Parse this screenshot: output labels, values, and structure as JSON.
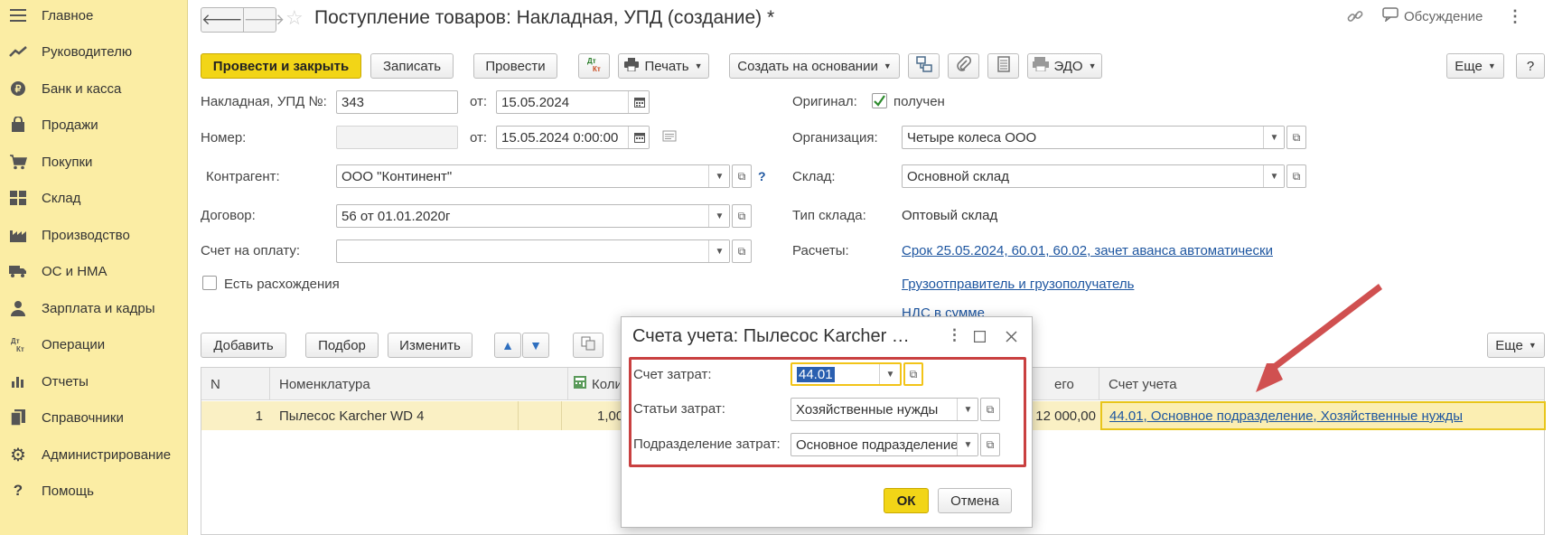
{
  "sidebar": {
    "items": [
      {
        "label": "Главное",
        "icon": "menu-icon"
      },
      {
        "label": "Руководителю",
        "icon": "trend-icon"
      },
      {
        "label": "Банк и касса",
        "icon": "coin-icon"
      },
      {
        "label": "Продажи",
        "icon": "bag-icon"
      },
      {
        "label": "Покупки",
        "icon": "cart-icon"
      },
      {
        "label": "Склад",
        "icon": "warehouse-icon"
      },
      {
        "label": "Производство",
        "icon": "factory-icon"
      },
      {
        "label": "ОС и НМА",
        "icon": "truck-icon"
      },
      {
        "label": "Зарплата и кадры",
        "icon": "person-icon"
      },
      {
        "label": "Операции",
        "icon": "dt-kt-icon"
      },
      {
        "label": "Отчеты",
        "icon": "bar-chart-icon"
      },
      {
        "label": "Справочники",
        "icon": "book-icon"
      },
      {
        "label": "Администрирование",
        "icon": "gear-icon"
      },
      {
        "label": "Помощь",
        "icon": "question-icon"
      }
    ]
  },
  "header": {
    "title": "Поступление товаров: Накладная, УПД (создание) *",
    "discussion_label": "Обсуждение"
  },
  "toolbar": {
    "post_close": "Провести и закрыть",
    "save": "Записать",
    "post": "Провести",
    "print": "Печать",
    "create_based": "Создать на основании",
    "edo": "ЭДО",
    "more": "Еще",
    "help": "?"
  },
  "form": {
    "invoice_no_label": "Накладная, УПД №:",
    "invoice_no": "343",
    "from_label": "от:",
    "invoice_date": "15.05.2024",
    "number_label": "Номер:",
    "number": "",
    "number_date": "15.05.2024  0:00:00",
    "counterparty_label": "Контрагент:",
    "counterparty": "ООО \"Континент\"",
    "contract_label": "Договор:",
    "contract": "56 от 01.01.2020г",
    "payment_account_label": "Счет на оплату:",
    "payment_account": "",
    "discrepancy_label": "Есть расхождения",
    "original_label": "Оригинал:",
    "original_value": "получен",
    "organization_label": "Организация:",
    "organization": "Четыре колеса ООО",
    "warehouse_label": "Склад:",
    "warehouse": "Основной склад",
    "warehouse_type_label": "Тип склада:",
    "warehouse_type": "Оптовый склад",
    "settlements_label": "Расчеты:",
    "settlements_link": "Срок 25.05.2024, 60.01, 60.02, зачет аванса автоматически",
    "shipper_link": "Грузоотправитель и грузополучатель",
    "vat_link": "НДС в сумме"
  },
  "table_toolbar": {
    "add": "Добавить",
    "pick": "Подбор",
    "change": "Изменить",
    "more": "Еще"
  },
  "table": {
    "headers": {
      "n": "N",
      "nomenclature": "Номенклатура",
      "qty": "Коли",
      "total": "его",
      "account": "Счет учета"
    },
    "rows": [
      {
        "n": "1",
        "nomenclature": "Пылесос Karcher WD 4",
        "qty": "1,00",
        "total": "12 000,00",
        "account": "44.01, Основное подразделение, Хозяйственные нужды"
      }
    ]
  },
  "dialog": {
    "title": "Счета учета: Пылесос Karcher …",
    "cost_account_label": "Счет затрат:",
    "cost_account": "44.01",
    "cost_item_label": "Статьи затрат:",
    "cost_item": "Хозяйственные нужды",
    "cost_division_label": "Подразделение затрат:",
    "cost_division": "Основное подразделение",
    "ok": "ОК",
    "cancel": "Отмена"
  },
  "colors": {
    "sidebar_bg": "#fbeda4",
    "primary_button": "#f2d517",
    "link": "#1e56a0",
    "annotation_red": "#d05050",
    "selected_row": "#faf0c4"
  }
}
